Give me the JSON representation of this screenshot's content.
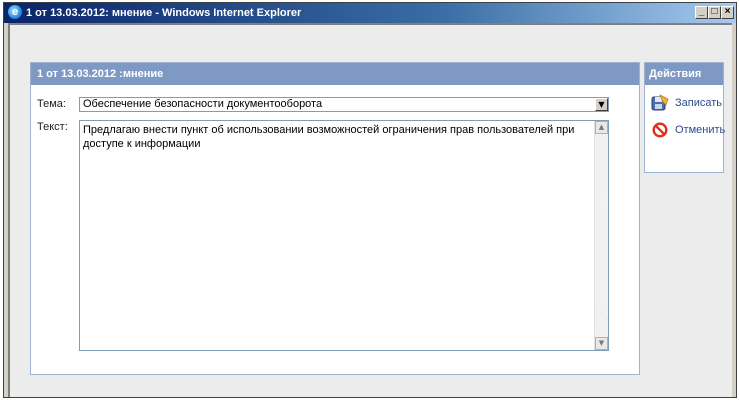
{
  "window": {
    "title": "1 от 13.03.2012: мнение - Windows Internet Explorer",
    "controls": {
      "minimize": "_",
      "maximize": "□",
      "close": "×"
    }
  },
  "form": {
    "header": "1 от 13.03.2012 :мнение",
    "topic_label": "Тема:",
    "topic_value": "Обеспечение безопасности документооборота",
    "text_label": "Текст:",
    "text_value": "Предлагаю внести пункт об использовании возможностей ограничения прав пользователей при доступе к информации"
  },
  "actions": {
    "header": "Действия",
    "save": "Записать",
    "cancel": "Отменить",
    "save_icon": "floppy-disk-icon",
    "cancel_icon": "no-entry-icon"
  },
  "colors": {
    "panel_header": "#7e9ac4",
    "title_bar": "#0a246a",
    "link": "#2b4c8c",
    "cancel_red": "#e0301e"
  }
}
